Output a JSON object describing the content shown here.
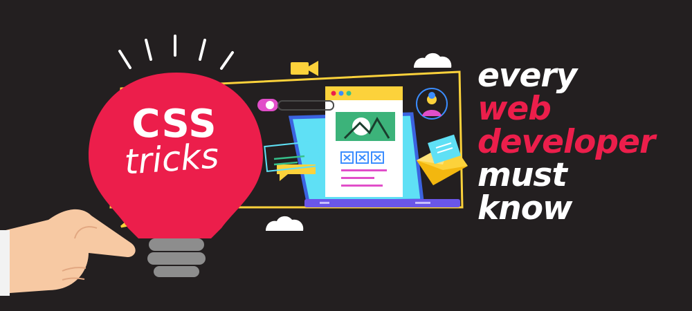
{
  "bulb": {
    "line1": "CSS",
    "line2": "tricks"
  },
  "headline": {
    "line1": "every",
    "line2": "web",
    "line3": "developer",
    "line4": "must",
    "line5": "know"
  },
  "colors": {
    "background": "#231f20",
    "accent_pink": "#ec1e4b",
    "accent_yellow": "#fcd23b",
    "laptop_blue": "#3b8dff",
    "screen_cyan": "#5fe0f5",
    "text_white": "#ffffff"
  },
  "icons": [
    "lightbulb-icon",
    "pointing-hand-icon",
    "laptop-icon",
    "video-camera-icon",
    "cloud-icon",
    "envelope-icon",
    "user-avatar-icon",
    "image-icon",
    "chat-bubble-icon",
    "toggle-icon"
  ]
}
